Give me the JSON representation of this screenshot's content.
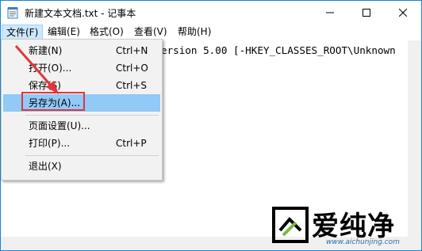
{
  "window": {
    "title": "新建文本文档.txt - 记事本"
  },
  "menubar": {
    "items": [
      {
        "label": "文件(F)",
        "active": true
      },
      {
        "label": "编辑(E)"
      },
      {
        "label": "格式(O)"
      },
      {
        "label": "查看(V)"
      },
      {
        "label": "帮助(H)"
      }
    ]
  },
  "editor": {
    "text": "ersion 5.00 [-HKEY_CLASSES_ROOT\\Unknown"
  },
  "file_menu": {
    "items": [
      {
        "label": "新建(N)",
        "shortcut": "Ctrl+N"
      },
      {
        "label": "打开(O)...",
        "shortcut": "Ctrl+O"
      },
      {
        "label": "保存(S)",
        "shortcut": "Ctrl+S"
      },
      {
        "label": "另存为(A)...",
        "shortcut": "",
        "highlighted": true
      },
      {
        "label": "页面设置(U)...",
        "shortcut": ""
      },
      {
        "label": "打印(P)...",
        "shortcut": "Ctrl+P"
      },
      {
        "label": "退出(X)",
        "shortcut": ""
      }
    ]
  },
  "watermark": {
    "brand": "爱纯净",
    "url": "www.aichunjing.com"
  },
  "colors": {
    "highlight_box": "#e2363b",
    "arrow": "#e2363b",
    "hover": "#91c9f7",
    "window_border": "#1883d7"
  },
  "icons": [
    "notepad-icon",
    "minimize-icon",
    "maximize-icon",
    "close-icon",
    "red-arrow-icon",
    "watermark-logo-icon"
  ]
}
